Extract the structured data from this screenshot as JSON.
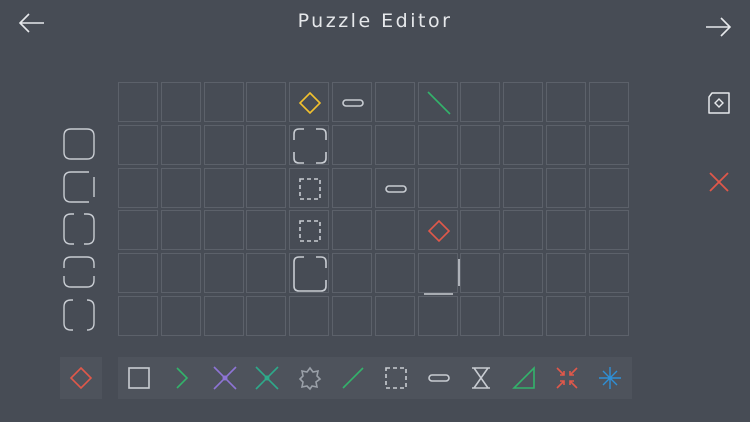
{
  "header": {
    "title": "Puzzle Editor",
    "back_icon": "arrow-left-icon",
    "forward_icon": "arrow-right-icon"
  },
  "side_actions": [
    {
      "icon": "tag-diamond-icon"
    },
    {
      "icon": "close-icon",
      "color": "#e0584a"
    }
  ],
  "board": {
    "columns": 12,
    "rows": 6,
    "pieces": [
      {
        "row": 0,
        "col": 4,
        "piece": "diamond",
        "color": "#f2c12e"
      },
      {
        "row": 0,
        "col": 5,
        "piece": "pill",
        "color": "#c8ccd2"
      },
      {
        "row": 0,
        "col": 7,
        "piece": "diagonal-line",
        "color": "#33b36b"
      },
      {
        "row": 1,
        "col": 4,
        "piece": "corner-bracket",
        "color": "#c8ccd2"
      },
      {
        "row": 2,
        "col": 4,
        "piece": "dashed-square",
        "color": "#c8ccd2"
      },
      {
        "row": 2,
        "col": 6,
        "piece": "pill",
        "color": "#c8ccd2"
      },
      {
        "row": 3,
        "col": 4,
        "piece": "dashed-square",
        "color": "#c8ccd2"
      },
      {
        "row": 3,
        "col": 7,
        "piece": "diamond",
        "color": "#e0584a"
      },
      {
        "row": 4,
        "col": 4,
        "piece": "rounded-corner",
        "color": "#c8ccd2"
      },
      {
        "row": 4,
        "col": 7,
        "piece": "wall-lines",
        "color": "#c8ccd2"
      }
    ]
  },
  "row_tiles": [
    {
      "style": "full"
    },
    {
      "style": "gap-right"
    },
    {
      "style": "gap-both"
    },
    {
      "style": "gap-mid"
    },
    {
      "style": "gap-wide"
    }
  ],
  "palette": {
    "selected": {
      "icon": "diamond-icon",
      "color": "#e0584a"
    },
    "tools": [
      {
        "icon": "square-icon",
        "color": "#c8ccd2"
      },
      {
        "icon": "chevron-right-icon",
        "color": "#33b36b"
      },
      {
        "icon": "x-cross-icon",
        "color": "#8e74d6"
      },
      {
        "icon": "x-cross-icon",
        "color": "#2eaa8a"
      },
      {
        "icon": "octagon-star-icon",
        "color": "#9aa0a8"
      },
      {
        "icon": "slash-icon",
        "color": "#33b36b"
      },
      {
        "icon": "dashed-square-icon",
        "color": "#c8ccd2"
      },
      {
        "icon": "pill-icon",
        "color": "#c8ccd2"
      },
      {
        "icon": "hourglass-icon",
        "color": "#c8ccd2"
      },
      {
        "icon": "triangle-icon",
        "color": "#33b36b"
      },
      {
        "icon": "shrink-arrows-icon",
        "color": "#e0584a"
      },
      {
        "icon": "sparkle-icon",
        "color": "#2e8fd6"
      }
    ]
  }
}
